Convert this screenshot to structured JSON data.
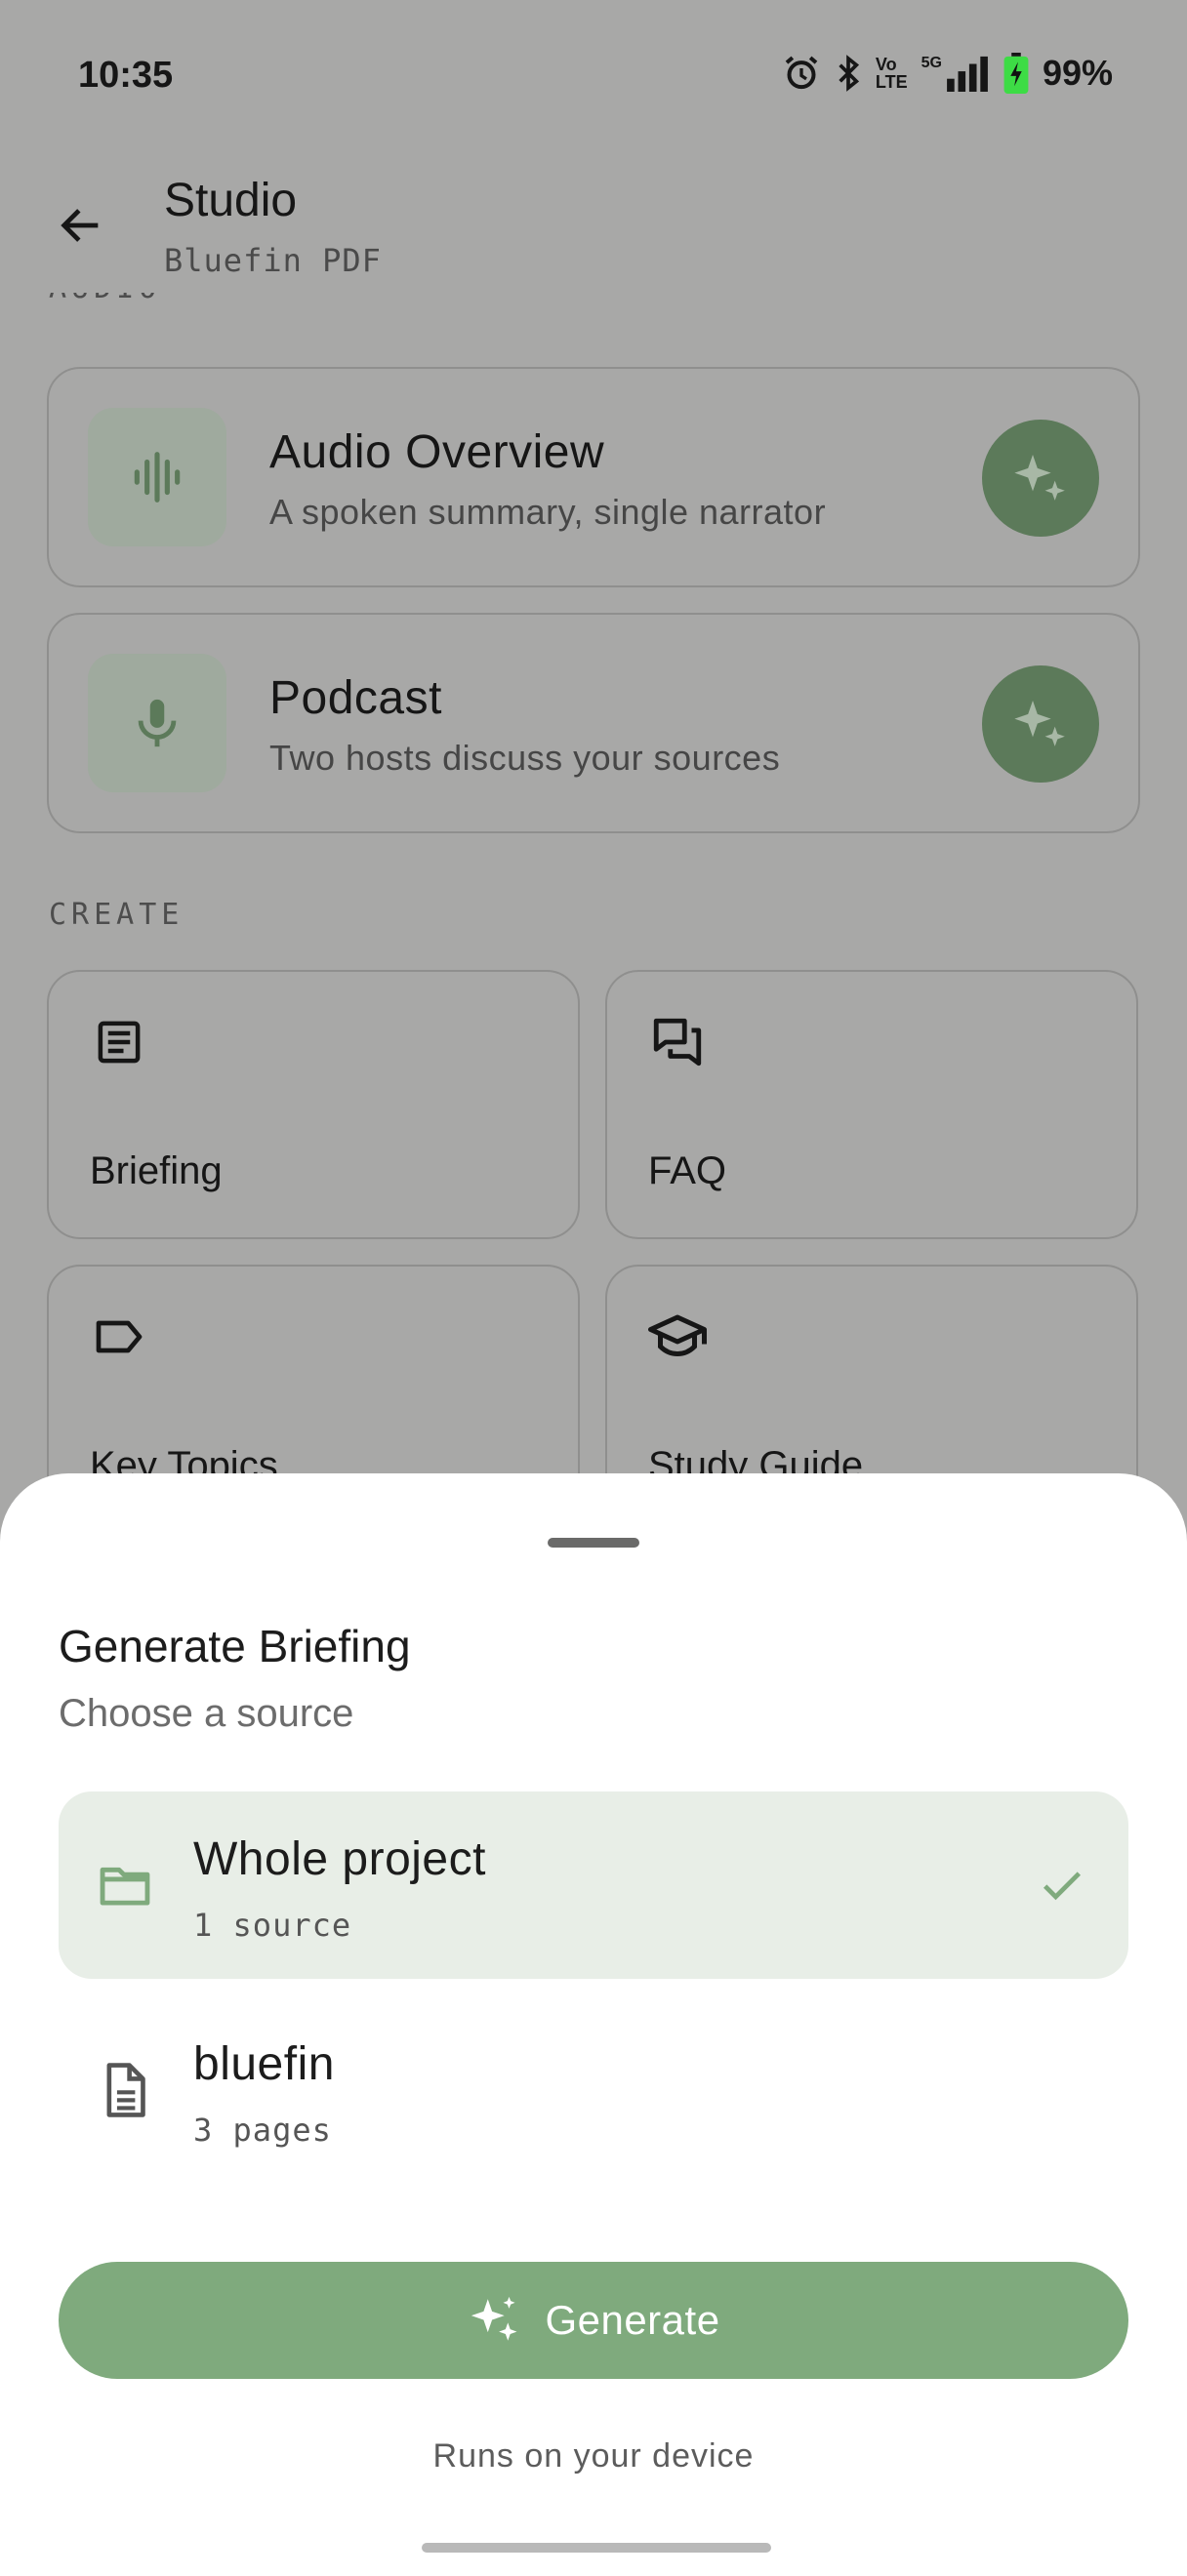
{
  "status_bar": {
    "time": "10:35",
    "battery": "99%",
    "icons": [
      "alarm-icon",
      "bluetooth-icon",
      "volte-icon",
      "5g-signal-icon",
      "battery-charging-icon"
    ],
    "network": "5G",
    "volte_line1": "Vo",
    "volte_line2": "LTE"
  },
  "app_bar": {
    "title": "Studio",
    "subtitle": "Bluefin PDF"
  },
  "sections": {
    "audio": "AUDIO",
    "create": "CREATE"
  },
  "audio_cards": [
    {
      "title": "Audio Overview",
      "description": "A spoken summary, single narrator",
      "icon": "waveform-icon"
    },
    {
      "title": "Podcast",
      "description": "Two hosts discuss your sources",
      "icon": "microphone-icon"
    }
  ],
  "create_tiles": [
    {
      "label": "Briefing",
      "icon": "article-icon"
    },
    {
      "label": "FAQ",
      "icon": "forum-icon"
    },
    {
      "label": "Key Topics",
      "icon": "label-icon"
    },
    {
      "label": "Study Guide",
      "icon": "school-icon"
    }
  ],
  "sheet": {
    "title": "Generate Briefing",
    "subtitle": "Choose a source",
    "options": [
      {
        "title": "Whole project",
        "meta": "1 source",
        "icon": "folder-icon",
        "selected": true
      },
      {
        "title": "bluefin",
        "meta": "3 pages",
        "icon": "document-icon",
        "selected": false
      }
    ],
    "generate_label": "Generate",
    "note": "Runs on your device"
  },
  "colors": {
    "scrim": "#a8a8a7",
    "accent": "#7faa7d",
    "accent_dark": "#5c7a5a",
    "selected_bg": "#e8eee7"
  }
}
